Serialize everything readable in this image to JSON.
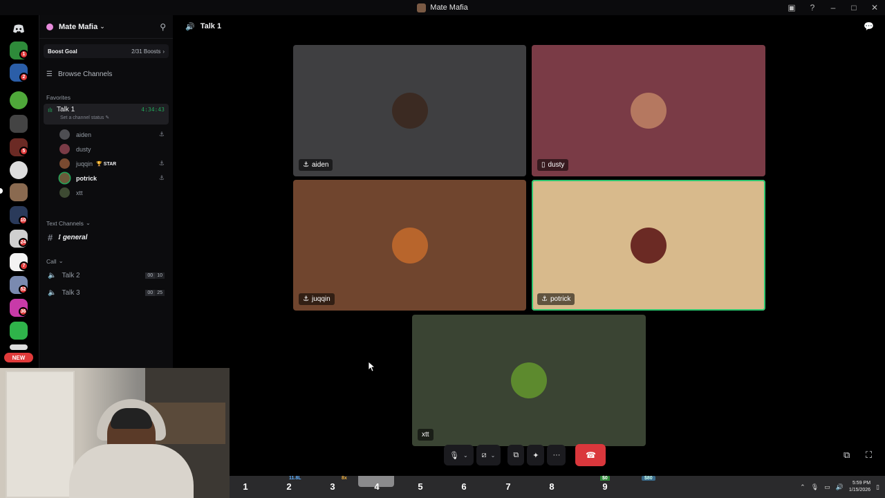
{
  "window": {
    "title": "Mate Mafia"
  },
  "server": {
    "name": "Mate Mafia"
  },
  "boost": {
    "label": "Boost Goal",
    "count": "2/31 Boosts"
  },
  "browse": {
    "label": "Browse Channels"
  },
  "favorites": {
    "heading": "Favorites",
    "channel": {
      "name": "Talk 1",
      "timer": "4:34:43",
      "status_placeholder": "Set a channel status"
    },
    "users": [
      {
        "name": "aiden",
        "color": "#4e4e52"
      },
      {
        "name": "dusty",
        "color": "#7a3b46"
      },
      {
        "name": "juqqin",
        "tag": "STAR",
        "color": "#7a4a30"
      },
      {
        "name": "potrick",
        "color": "#6b5a3a"
      },
      {
        "name": "xtt",
        "color": "#3d4a32"
      }
    ]
  },
  "text_channels": {
    "heading": "Text Channels",
    "items": [
      {
        "name": "general"
      }
    ]
  },
  "call": {
    "heading": "Call",
    "items": [
      {
        "name": "Talk 2",
        "count_a": "00",
        "count_b": "10"
      },
      {
        "name": "Talk 3",
        "count_a": "00",
        "count_b": "25"
      }
    ]
  },
  "rail": {
    "new_label": "NEW",
    "pings": [
      "1",
      "2",
      "5",
      "10",
      "24",
      "7",
      "52",
      "36"
    ]
  },
  "voice": {
    "channel": "Talk 1"
  },
  "tiles": [
    {
      "name": "aiden",
      "bg": "#3f3f41",
      "face": "#3b2a22"
    },
    {
      "name": "dusty",
      "bg": "#7a3b46",
      "face": "#b57860"
    },
    {
      "name": "juqqin",
      "bg": "#70452e",
      "face": "#b8652c"
    },
    {
      "name": "potrick",
      "bg": "#d8ba8c",
      "face": "#6b2a24"
    },
    {
      "name": "xtt",
      "bg": "#3a4433",
      "face": "#5d8a2e"
    }
  ],
  "taskbar": {
    "slots": [
      "1",
      "2",
      "3",
      "4",
      "5",
      "6",
      "7",
      "8",
      "9"
    ],
    "tags": [
      "11.8L",
      "8x",
      "$0",
      "$80"
    ],
    "time": "5:59 PM",
    "date": "1/15/2026"
  }
}
